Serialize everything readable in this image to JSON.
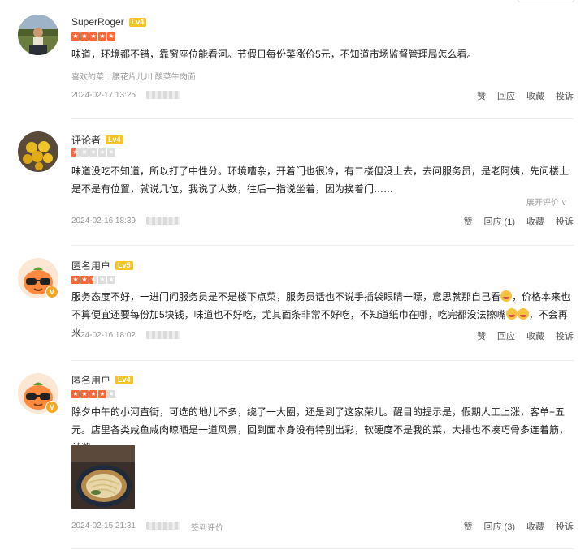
{
  "reviews": [
    {
      "user": "SuperRoger",
      "level": "Lv4",
      "rating": 5,
      "text": "味道，环境都不错，靠窗座位能看河。节假日每份菜涨价5元，不知道市场监督管理局怎么看。",
      "favorites": "喜欢的菜：腰花片儿川 酸菜牛肉面",
      "date": "2024-02-17 13:25",
      "actions": {
        "like": "赞",
        "reply": "回应",
        "fav": "收藏",
        "report": "投诉"
      }
    },
    {
      "user": "评论者",
      "level": "Lv4",
      "rating": 0.5,
      "text": "味道没吃不知道，所以打了中性分。环境嘈杂，开着门也很冷，有二楼但没上去，去问服务员，是老阿姨，先问楼上是不是有位置，就说几位，我说了人数，往后一指说坐着，因为挨着门……",
      "expand": "展开评价 ∨",
      "date": "2024-02-16 18:39",
      "actions": {
        "like": "赞",
        "reply": "回应 (1)",
        "fav": "收藏",
        "report": "投诉"
      }
    },
    {
      "user": "匿名用户",
      "level": "Lv5",
      "rating": 2.5,
      "text_a": "服务态度不好，一进门问服务员是不是楼下点菜，服务员话也不说手插袋眼睛一瞟，意思就那自己看",
      "text_b": "，价格本来也不算便宜还要每份加5块钱，味道也不好吃，尤其面条非常不好吃，不知道纸巾在哪，吃完都没法擦嘴",
      "text_c": "，不会再来",
      "date": "2024-02-16 18:02",
      "actions": {
        "like": "赞",
        "reply": "回应",
        "fav": "收藏",
        "report": "投诉"
      }
    },
    {
      "user": "匿名用户",
      "level": "Lv4",
      "rating": 4,
      "text": "除夕中午的小河直街，可选的地儿不多，绕了一大圈，还是到了这家荣儿。醒目的提示是，假期人工上涨，客单+五元。店里各类咸鱼咸肉晾晒是一道风景，回到面本身没有特别出彩，软硬度不是我的菜，大排也不凑巧骨多连着筋，就酱",
      "date": "2024-02-15 21:31",
      "checkin": "签到评价",
      "actions": {
        "like": "赞",
        "reply": "回应 (3)",
        "fav": "收藏",
        "report": "投诉"
      }
    }
  ],
  "colors": {
    "star": "#ff6633",
    "level_badge": "#f7c325",
    "vip_badge": "#f5a623"
  },
  "icons": [
    "star-icon",
    "vip-badge-icon",
    "emoji-icon",
    "chevron-down-icon"
  ]
}
